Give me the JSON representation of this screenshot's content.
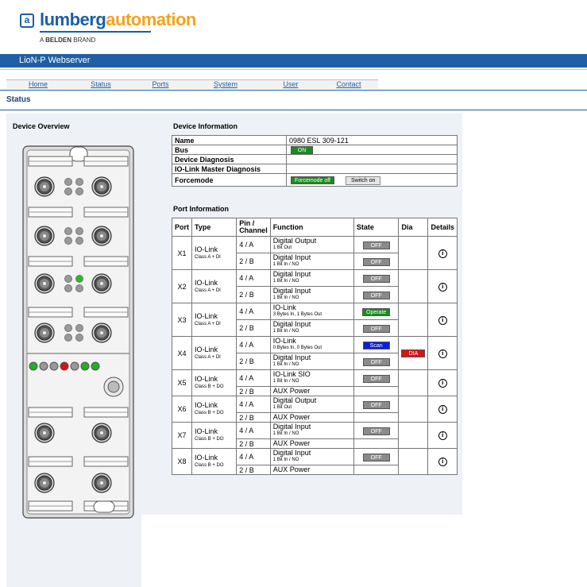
{
  "header": {
    "logo_letter": "a",
    "logo_part1": "lumberg",
    "logo_part2": "automation",
    "brand_prefix": "A",
    "brand_name": "BELDEN",
    "brand_suffix": "BRAND"
  },
  "titlebar": "LioN-P Webserver",
  "nav": [
    "Home",
    "Status",
    "Ports",
    "System",
    "User",
    "Contact"
  ],
  "page_title": "Status",
  "device_overview_title": "Device Overview",
  "device_info": {
    "title": "Device Information",
    "rows": [
      {
        "key": "Name",
        "value": "0980 ESL 309-121"
      },
      {
        "key": "Bus",
        "value": "ON"
      },
      {
        "key": "Device Diagnosis",
        "value": ""
      },
      {
        "key": "IO-Link Master Diagnosis",
        "value": ""
      },
      {
        "key": "Forcemode",
        "value": "Forcemode off",
        "button": "Switch on"
      }
    ]
  },
  "port_info": {
    "title": "Port Information",
    "headers": [
      "Port",
      "Type",
      "Pin / Channel",
      "Function",
      "State",
      "Dia",
      "Details"
    ],
    "ports": [
      {
        "port": "X1",
        "type": "IO-Link",
        "type_sub": "Class A + DI",
        "dia": "",
        "rows": [
          {
            "pin": "4 / A",
            "fn": "Digital Output",
            "fn_sub": "1 Bit Out",
            "state": "OFF",
            "state_color": "grey"
          },
          {
            "pin": "2 / B",
            "fn": "Digital Input",
            "fn_sub": "1 Bit In / NO",
            "state": "OFF",
            "state_color": "grey"
          }
        ]
      },
      {
        "port": "X2",
        "type": "IO-Link",
        "type_sub": "Class A + DI",
        "dia": "",
        "rows": [
          {
            "pin": "4 / A",
            "fn": "Digital Input",
            "fn_sub": "1 Bit In / NO",
            "state": "OFF",
            "state_color": "grey"
          },
          {
            "pin": "2 / B",
            "fn": "Digital Input",
            "fn_sub": "1 Bit In / NO",
            "state": "OFF",
            "state_color": "grey"
          }
        ]
      },
      {
        "port": "X3",
        "type": "IO-Link",
        "type_sub": "Class A + DI",
        "dia": "",
        "rows": [
          {
            "pin": "4 / A",
            "fn": "IO-Link",
            "fn_sub": "3 Bytes In, 1 Bytes Out",
            "state": "Operate",
            "state_color": "green"
          },
          {
            "pin": "2 / B",
            "fn": "Digital Input",
            "fn_sub": "1 Bit In / NO",
            "state": "OFF",
            "state_color": "grey"
          }
        ]
      },
      {
        "port": "X4",
        "type": "IO-Link",
        "type_sub": "Class A + DI",
        "dia": "DIA",
        "rows": [
          {
            "pin": "4 / A",
            "fn": "IO-Link",
            "fn_sub": "0 Bytes In, 0 Bytes Out",
            "state": "Scan",
            "state_color": "blue"
          },
          {
            "pin": "2 / B",
            "fn": "Digital Input",
            "fn_sub": "1 Bit In / NO",
            "state": "OFF",
            "state_color": "grey"
          }
        ]
      },
      {
        "port": "X5",
        "type": "IO-Link",
        "type_sub": "Class B + DO",
        "dia": "",
        "rows": [
          {
            "pin": "4 / A",
            "fn": "IO-Link SIO",
            "fn_sub": "1 Bit In / NO",
            "state": "OFF",
            "state_color": "grey"
          },
          {
            "pin": "2 / B",
            "fn": "AUX Power",
            "fn_sub": "",
            "state": "",
            "state_color": ""
          }
        ]
      },
      {
        "port": "X6",
        "type": "IO-Link",
        "type_sub": "Class B + DO",
        "dia": "",
        "rows": [
          {
            "pin": "4 / A",
            "fn": "Digital Output",
            "fn_sub": "1 Bit Out",
            "state": "OFF",
            "state_color": "grey"
          },
          {
            "pin": "2 / B",
            "fn": "AUX Power",
            "fn_sub": "",
            "state": "",
            "state_color": ""
          }
        ]
      },
      {
        "port": "X7",
        "type": "IO-Link",
        "type_sub": "Class B + DO",
        "dia": "",
        "rows": [
          {
            "pin": "4 / A",
            "fn": "Digital Input",
            "fn_sub": "1 Bit In / NO",
            "state": "OFF",
            "state_color": "grey"
          },
          {
            "pin": "2 / B",
            "fn": "AUX Power",
            "fn_sub": "",
            "state": "",
            "state_color": ""
          }
        ]
      },
      {
        "port": "X8",
        "type": "IO-Link",
        "type_sub": "Class B + DO",
        "dia": "",
        "rows": [
          {
            "pin": "4 / A",
            "fn": "Digital Input",
            "fn_sub": "1 Bit In / NO",
            "state": "OFF",
            "state_color": "grey"
          },
          {
            "pin": "2 / B",
            "fn": "AUX Power",
            "fn_sub": "",
            "state": "",
            "state_color": ""
          }
        ]
      }
    ]
  },
  "details_icon": "info-icon",
  "colors": {
    "brand_blue": "#1f5fa6",
    "brand_orange": "#f7a21b",
    "on_green": "#1b8a1f",
    "scan_blue": "#0b1ee0",
    "dia_red": "#d61414"
  }
}
